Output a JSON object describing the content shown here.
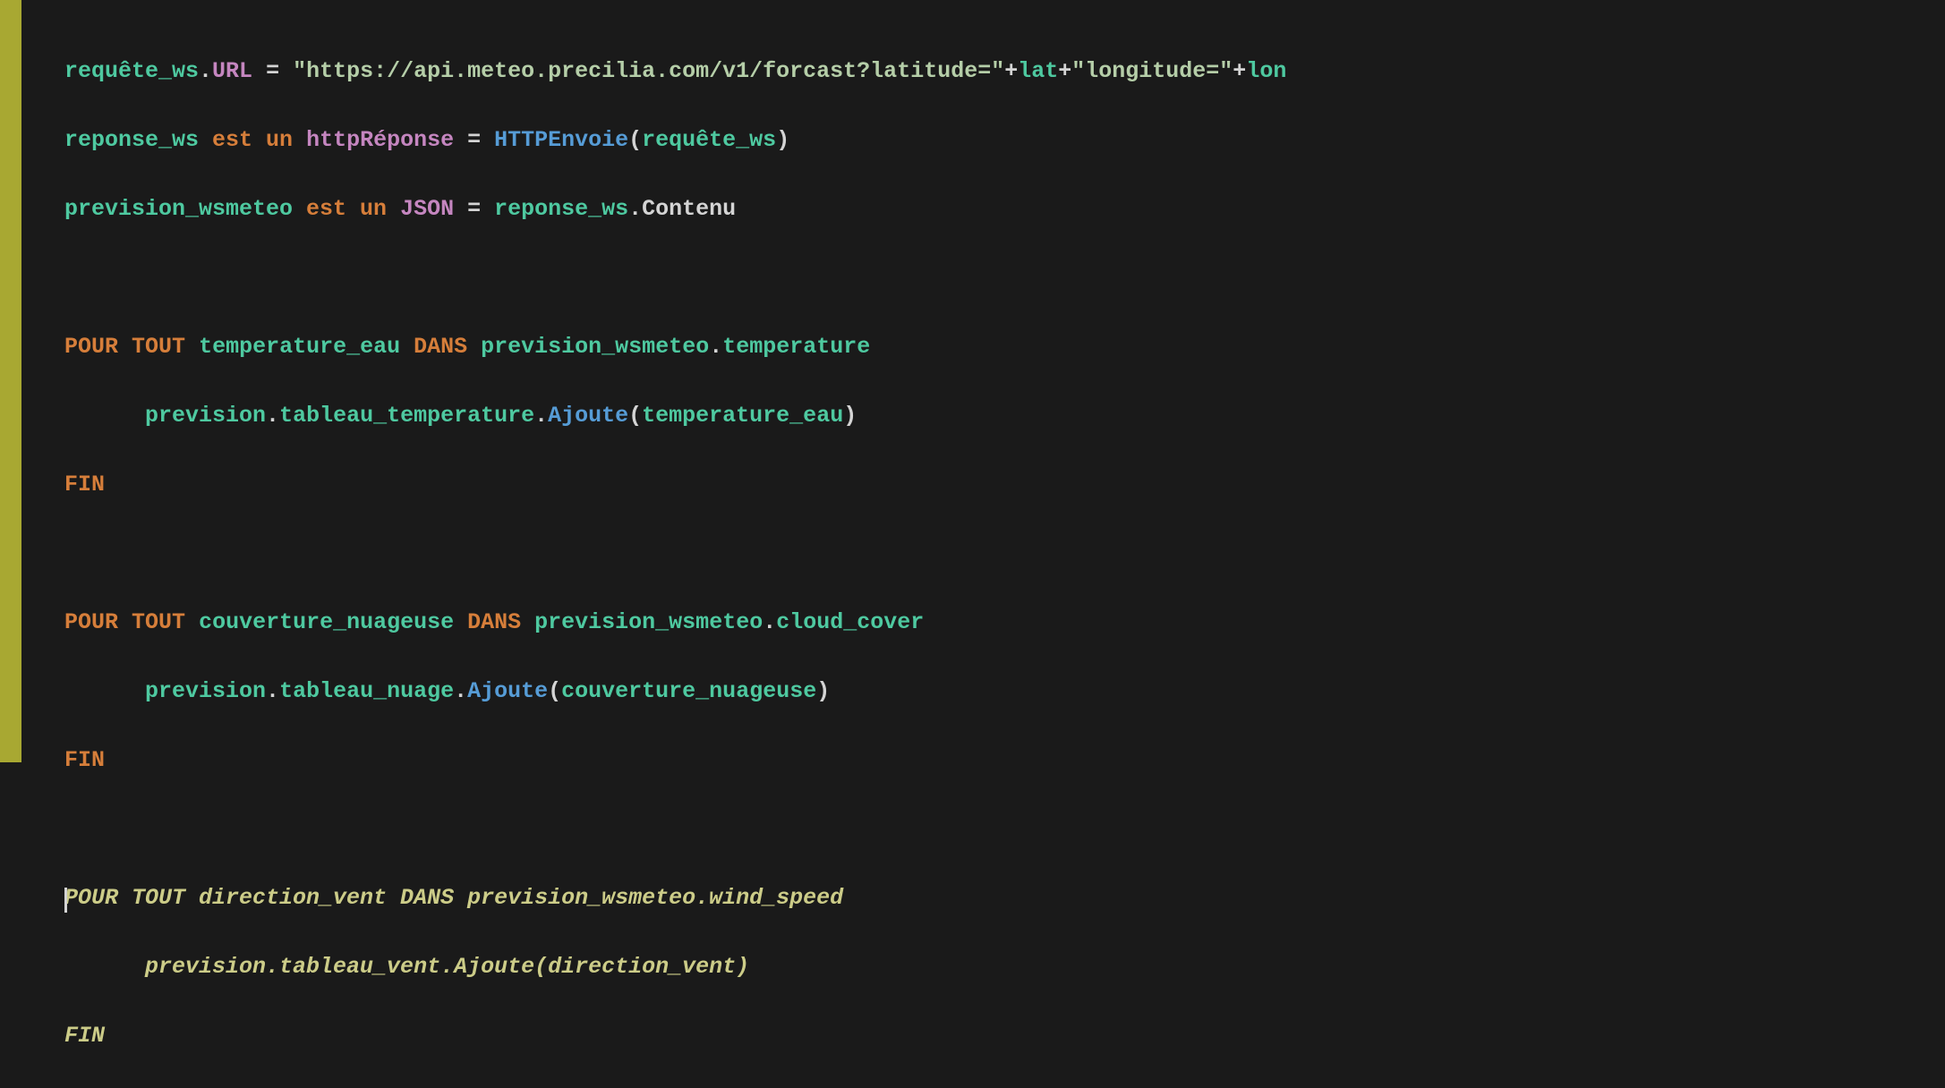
{
  "code": {
    "line1": {
      "var1": "requête_ws",
      "dot1": ".",
      "prop1": "URL",
      "eq": " = ",
      "str": "\"https://api.meteo.precilia.com/v1/forcast?latitude=\"",
      "plus1": "+",
      "var2": "lat",
      "plus2": "+",
      "str2": "\"longitude=\"",
      "plus3": "+",
      "var3": "lon"
    },
    "line2": {
      "var1": "reponse_ws",
      "kw1": " est un ",
      "type1": "httpRéponse",
      "eq": " = ",
      "fn": "HTTPEnvoie",
      "paren1": "(",
      "arg": "requête_ws",
      "paren2": ")"
    },
    "line3": {
      "var1": "prevision_wsmeteo",
      "kw1": " est un ",
      "type1": "JSON",
      "eq": " = ",
      "var2": "reponse_ws",
      "dot": ".",
      "prop": "Contenu"
    },
    "line5": {
      "kw1": "POUR",
      "sp1": " ",
      "kw2": "TOUT",
      "sp2": " ",
      "var1": "temperature_eau",
      "sp3": " ",
      "kw3": "DANS",
      "sp4": " ",
      "var2": "prevision_wsmeteo",
      "dot": ".",
      "prop": "temperature"
    },
    "line6": {
      "indent": "      ",
      "var1": "prevision",
      "dot1": ".",
      "prop1": "tableau_temperature",
      "dot2": ".",
      "method": "Ajoute",
      "paren1": "(",
      "arg": "temperature_eau",
      "paren2": ")"
    },
    "line7": {
      "kw": "FIN"
    },
    "line9": {
      "kw1": "POUR",
      "sp1": " ",
      "kw2": "TOUT",
      "sp2": " ",
      "var1": "couverture_nuageuse",
      "sp3": " ",
      "kw3": "DANS",
      "sp4": " ",
      "var2": "prevision_wsmeteo",
      "dot": ".",
      "prop": "cloud_cover"
    },
    "line10": {
      "indent": "      ",
      "var1": "prevision",
      "dot1": ".",
      "prop1": "tableau_nuage",
      "dot2": ".",
      "method": "Ajoute",
      "paren1": "(",
      "arg": "couverture_nuageuse",
      "paren2": ")"
    },
    "line11": {
      "kw": "FIN"
    },
    "line13": {
      "text": "POUR TOUT direction_vent DANS prevision_wsmeteo.wind_speed"
    },
    "line14": {
      "indent": "      ",
      "text": "prevision.tableau_vent.Ajoute(direction_vent)"
    },
    "line15": {
      "text": "FIN"
    }
  }
}
